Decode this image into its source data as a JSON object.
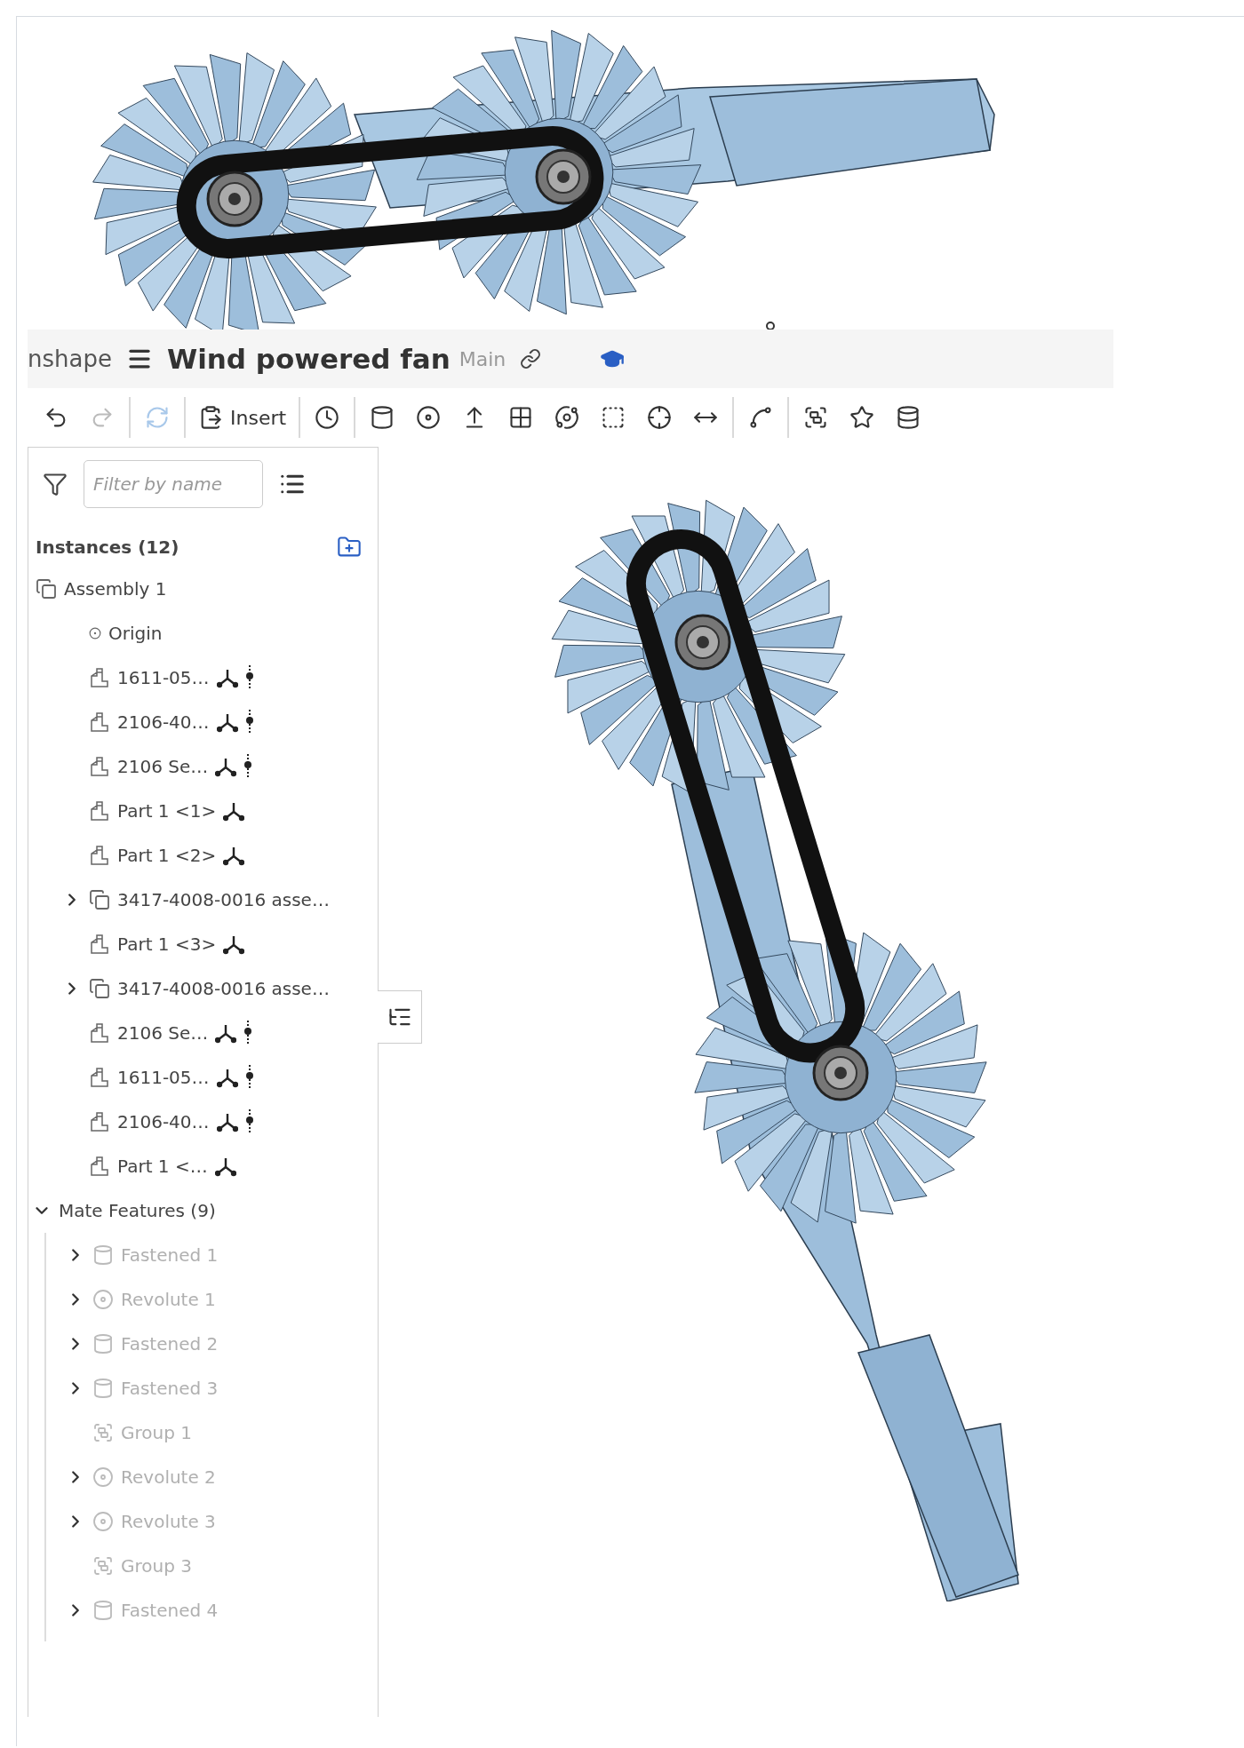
{
  "header": {
    "app_name": "nshape",
    "title": "Wind powered fan",
    "branch": "Main"
  },
  "toolbar": {
    "items": [
      {
        "kind": "undo",
        "disabled": false
      },
      {
        "kind": "redo",
        "disabled": true
      },
      {
        "kind": "separator"
      },
      {
        "kind": "regenerate",
        "disabled": true
      },
      {
        "kind": "separator"
      },
      {
        "kind": "insert",
        "label": "Insert",
        "disabled": false
      },
      {
        "kind": "separator"
      },
      {
        "kind": "history",
        "disabled": false
      },
      {
        "kind": "separator"
      },
      {
        "kind": "fastened",
        "disabled": false
      },
      {
        "kind": "revolute",
        "disabled": false
      },
      {
        "kind": "slider",
        "disabled": false
      },
      {
        "kind": "planar",
        "disabled": false
      },
      {
        "kind": "ball",
        "disabled": false
      },
      {
        "kind": "cylindrical",
        "disabled": false
      },
      {
        "kind": "pin_slot",
        "disabled": false
      },
      {
        "kind": "parallel",
        "disabled": false
      },
      {
        "kind": "separator"
      },
      {
        "kind": "tangent",
        "disabled": false
      },
      {
        "kind": "separator"
      },
      {
        "kind": "group",
        "disabled": false
      },
      {
        "kind": "connector",
        "disabled": false
      },
      {
        "kind": "replicate",
        "disabled": false
      }
    ]
  },
  "panel": {
    "filter_placeholder": "Filter by name",
    "instances_title": "Instances (12)",
    "instances": [
      {
        "kind": "assembly",
        "label": "Assembly 1",
        "expandable": false,
        "connector": false,
        "linked": false,
        "children": [
          {
            "kind": "origin",
            "label": "Origin",
            "expandable": false,
            "connector": false,
            "linked": false
          },
          {
            "kind": "part",
            "label": "1611-05…",
            "expandable": false,
            "connector": true,
            "linked": true
          },
          {
            "kind": "part",
            "label": "2106-40…",
            "expandable": false,
            "connector": true,
            "linked": true
          },
          {
            "kind": "part",
            "label": "2106 Se…",
            "expandable": false,
            "connector": true,
            "linked": true
          },
          {
            "kind": "part",
            "label": "Part 1 <1>",
            "expandable": false,
            "connector": true,
            "linked": false
          },
          {
            "kind": "part",
            "label": "Part 1 <2>",
            "expandable": false,
            "connector": true,
            "linked": false
          },
          {
            "kind": "assembly",
            "label": "3417-4008-0016 asse…",
            "expandable": true,
            "connector": false,
            "linked": false
          },
          {
            "kind": "part",
            "label": "Part 1 <3>",
            "expandable": false,
            "connector": true,
            "linked": false
          },
          {
            "kind": "assembly",
            "label": "3417-4008-0016 asse…",
            "expandable": true,
            "connector": false,
            "linked": false
          },
          {
            "kind": "part",
            "label": "2106 Se…",
            "expandable": false,
            "connector": true,
            "linked": true
          },
          {
            "kind": "part",
            "label": "1611-05…",
            "expandable": false,
            "connector": true,
            "linked": true
          },
          {
            "kind": "part",
            "label": "2106-40…",
            "expandable": false,
            "connector": true,
            "linked": true
          },
          {
            "kind": "part",
            "label": "Part 1 <…",
            "expandable": false,
            "connector": true,
            "linked": false
          }
        ]
      }
    ],
    "mates": {
      "label": "Mate Features (9)",
      "expanded": true,
      "items": [
        {
          "kind": "fastened",
          "label": "Fastened 1",
          "expandable": true,
          "suppressed": true
        },
        {
          "kind": "revolute",
          "label": "Revolute 1",
          "expandable": true,
          "suppressed": true
        },
        {
          "kind": "fastened",
          "label": "Fastened 2",
          "expandable": true,
          "suppressed": true
        },
        {
          "kind": "fastened",
          "label": "Fastened 3",
          "expandable": true,
          "suppressed": true
        },
        {
          "kind": "group",
          "label": "Group 1",
          "expandable": false,
          "suppressed": true
        },
        {
          "kind": "revolute",
          "label": "Revolute 2",
          "expandable": true,
          "suppressed": true
        },
        {
          "kind": "revolute",
          "label": "Revolute 3",
          "expandable": true,
          "suppressed": true
        },
        {
          "kind": "group",
          "label": "Group 3",
          "expandable": false,
          "suppressed": true
        },
        {
          "kind": "fastened",
          "label": "Fastened 4",
          "expandable": true,
          "suppressed": true
        }
      ]
    }
  }
}
